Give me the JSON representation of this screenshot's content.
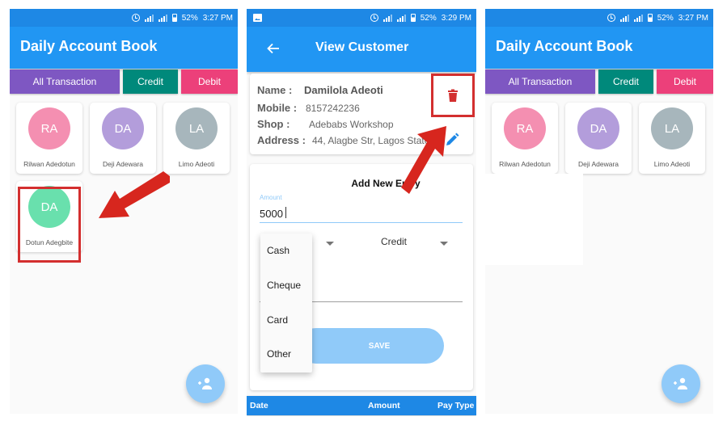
{
  "status_bar": {
    "left": {
      "alarm_icon": "alarm-icon",
      "signal_icon": "signal-icon",
      "battery_icon": "battery-icon",
      "battery": "52%",
      "time": "3:27 PM"
    },
    "middle": {
      "image_icon": "image-icon",
      "battery": "52%",
      "time": "3:29 PM"
    },
    "right": {
      "battery": "52%",
      "time": "3:27 PM"
    }
  },
  "home": {
    "title": "Daily Account Book",
    "tabs": [
      {
        "label": "All Transaction",
        "color": "#7e57c2"
      },
      {
        "label": "Credit",
        "color": "#00897b"
      },
      {
        "label": "Debit",
        "color": "#ec407a"
      }
    ],
    "customers": [
      {
        "initials": "RA",
        "name": "Rilwan Adedotun",
        "color": "#f06292"
      },
      {
        "initials": "DA",
        "name": "Deji Adewara",
        "color": "#9575cd"
      },
      {
        "initials": "LA",
        "name": "Limo Adeoti",
        "color": "#90a4ae"
      },
      {
        "initials": "DA",
        "name": "Dotun Adegbite",
        "color": "#4dd0a0"
      }
    ],
    "fab_icon": "add-person-icon"
  },
  "home_right": {
    "customers": [
      {
        "initials": "RA",
        "name": "Rilwan Adedotun",
        "color": "#f06292"
      },
      {
        "initials": "DA",
        "name": "Deji Adewara",
        "color": "#9575cd"
      },
      {
        "initials": "LA",
        "name": "Limo Adeoti",
        "color": "#90a4ae"
      }
    ]
  },
  "view_customer": {
    "title": "View Customer",
    "back_icon": "arrow-back-icon",
    "fields": [
      {
        "key": "Name :",
        "value": "Damilola Adeoti"
      },
      {
        "key": "Mobile :",
        "value": "8157242236"
      },
      {
        "key": "Shop :",
        "value": "Adebabs Workshop"
      },
      {
        "key": "Address :",
        "value": "44, Alagbe Str, Lagos State"
      }
    ],
    "delete_icon": "trash-icon",
    "edit_icon": "pencil-icon",
    "entry": {
      "title": "Add New Entry",
      "amount_label": "Amount",
      "amount_value": "5000",
      "type_selected": "Credit",
      "pay_type_options": [
        "Cash",
        "Cheque",
        "Card",
        "Other"
      ],
      "save_label": "SAVE"
    },
    "table_headers": [
      "Date",
      "Amount",
      "Pay Type"
    ]
  },
  "colors": {
    "primary": "#2196f3",
    "status_bar": "#1e88e5",
    "highlight": "#d32f2f",
    "fab": "#90caf9"
  }
}
